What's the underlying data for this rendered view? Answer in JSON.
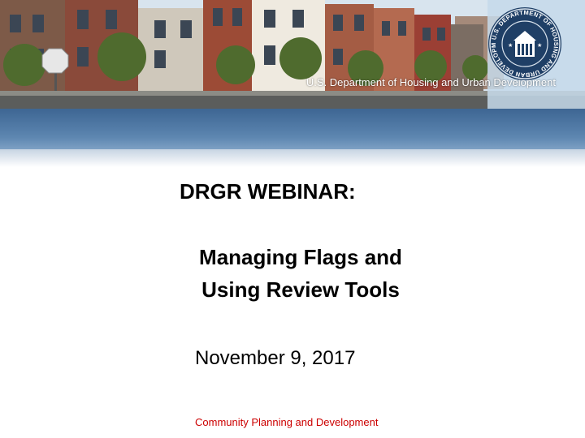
{
  "header": {
    "agency_caption": "U.S. Department of Housing and Urban Development",
    "seal_text": "U.S. DEPARTMENT OF HOUSING AND URBAN DEVELOPMENT"
  },
  "slide": {
    "headline": "DRGR WEBINAR:",
    "subtitle_line1": "Managing Flags and",
    "subtitle_line2": "Using Review Tools",
    "date": "November 9, 2017",
    "footer": "Community Planning and Development"
  },
  "colors": {
    "band_blue": "#4f78a4",
    "footer_red": "#cc0000"
  }
}
